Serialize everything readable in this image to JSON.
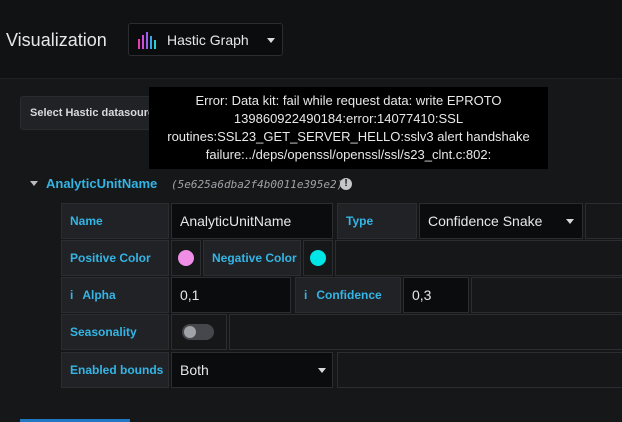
{
  "header": {
    "title": "Visualization",
    "viz_picker": {
      "label": "Hastic Graph",
      "icon": "hastic-logo-icon"
    }
  },
  "datasource": {
    "label": "Select Hastic datasource"
  },
  "tooltip": {
    "lines": [
      "Error: Data kit: fail while request data: write EPROTO",
      "139860922490184:error:14077410:SSL",
      "routines:SSL23_GET_SERVER_HELLO:sslv3 alert handshake",
      "failure:../deps/openssl/openssl/ssl/s23_clnt.c:802:"
    ]
  },
  "unit": {
    "name": "AnalyticUnitName",
    "id": "(5e625a6dba2f4b0011e395e2)",
    "warning_icon": "!"
  },
  "form": {
    "name_label": "Name",
    "name_value": "AnalyticUnitName",
    "type_label": "Type",
    "type_value": "Confidence Snake",
    "positive_color_label": "Positive Color",
    "positive_color": "#f08ee6",
    "negative_color_label": "Negative Color",
    "negative_color": "#00e5e5",
    "alpha_info": "i",
    "alpha_label": "Alpha",
    "alpha_value": "0,1",
    "confidence_info": "i",
    "confidence_label": "Confidence",
    "confidence_value": "0,3",
    "seasonality_label": "Seasonality",
    "seasonality_on": false,
    "bounds_label": "Enabled bounds",
    "bounds_value": "Both"
  }
}
